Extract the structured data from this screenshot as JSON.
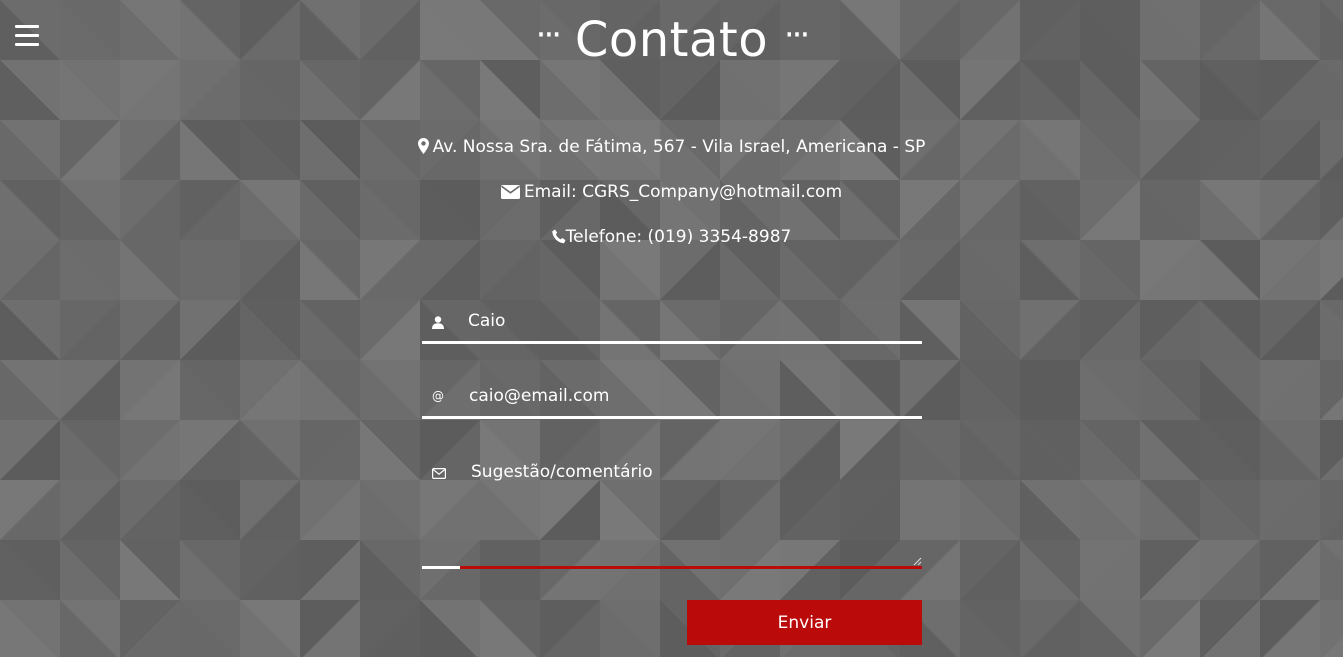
{
  "page": {
    "title": "Contato",
    "title_dots": "···"
  },
  "contact": {
    "address": "Av. Nossa Sra. de Fátima, 567 - Vila Israel, Americana - SP",
    "email": "Email: CGRS_Company@hotmail.com",
    "phone": "Telefone: (019) 3354-8987"
  },
  "form": {
    "name_value": "Caio",
    "email_value": "caio@email.com",
    "message_value": "Sugestão/comentário",
    "submit_label": "Enviar",
    "name_icon": "user-icon",
    "email_icon": "at-icon",
    "message_icon": "envelope-outline-icon"
  },
  "icons": {
    "menu": "hamburger-menu-icon",
    "address": "map-marker-icon",
    "email": "envelope-icon",
    "phone": "phone-icon"
  },
  "colors": {
    "background": "#6a6a6a",
    "accent": "#bb0a0a",
    "text": "#ffffff",
    "underline": "#ffffff",
    "focus_underline": "#bb0a0a"
  }
}
